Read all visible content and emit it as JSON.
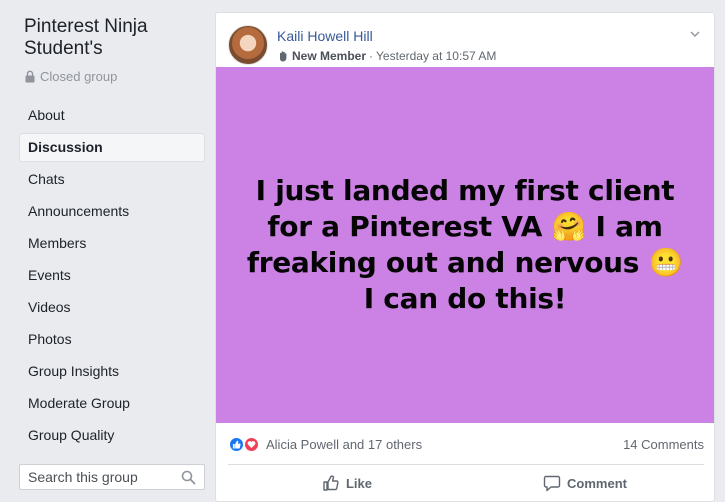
{
  "group": {
    "name": "Pinterest Ninja Student's",
    "privacy": "Closed group"
  },
  "nav": {
    "items": [
      {
        "label": "About"
      },
      {
        "label": "Discussion"
      },
      {
        "label": "Chats"
      },
      {
        "label": "Announcements"
      },
      {
        "label": "Members"
      },
      {
        "label": "Events"
      },
      {
        "label": "Videos"
      },
      {
        "label": "Photos"
      },
      {
        "label": "Group Insights"
      },
      {
        "label": "Moderate Group"
      },
      {
        "label": "Group Quality"
      }
    ],
    "active": "Discussion"
  },
  "search": {
    "placeholder": "Search this group"
  },
  "post": {
    "author": "Kaili Howell Hill",
    "badge": "New Member",
    "separator": "·",
    "timestamp": "Yesterday at 10:57 AM",
    "text": "I just landed my first client for a Pinterest VA 🤗 I am freaking out and nervous 😬 I can do this!",
    "background_color": "#cc82e4",
    "reactors": "Alicia Powell and 17 others",
    "comments": "14 Comments",
    "like_label": "Like",
    "comment_label": "Comment"
  }
}
